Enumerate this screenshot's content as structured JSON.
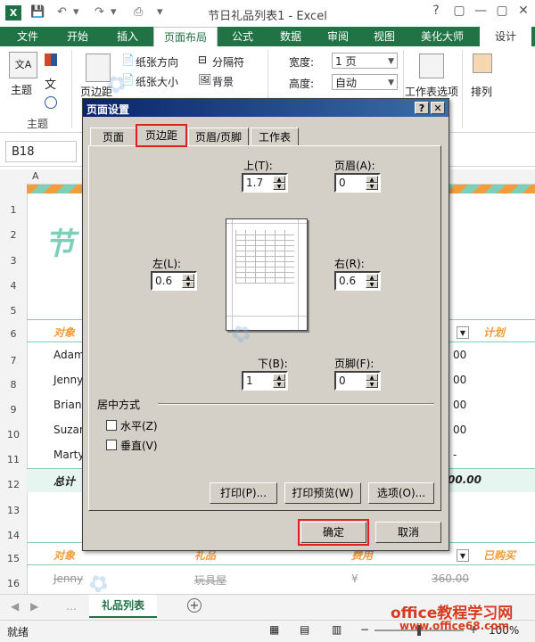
{
  "window": {
    "title": "节日礼品列表1 - Excel",
    "logo": "X",
    "controls": [
      "?",
      "▢",
      "—",
      "▢",
      "✕"
    ]
  },
  "ribbon_tabs": [
    "文件",
    "开始",
    "插入",
    "页面布局",
    "公式",
    "数据",
    "审阅",
    "视图",
    "美化大师",
    "设计"
  ],
  "ribbon": {
    "theme_label": "主题",
    "group_theme": "主题",
    "margins_label": "页边距",
    "orientation_label": "纸张方向",
    "size_label": "纸张大小",
    "breaks_label": "分隔符",
    "background_label": "背景",
    "width_label": "宽度:",
    "height_label": "高度:",
    "width_value": "1 页",
    "height_value": "自动",
    "sheet_options_label": "工作表选项",
    "arrange_label": "排列"
  },
  "formula_bar": {
    "name_box": "B18"
  },
  "sheet": {
    "col_a": "A",
    "row_numbers": [
      "1",
      "2",
      "3",
      "4",
      "5",
      "6",
      "7",
      "8",
      "9",
      "10",
      "11",
      "12",
      "13",
      "14",
      "15",
      "16"
    ],
    "title_partial": "节",
    "header_object": "对象",
    "header_plan": "计划",
    "names": [
      "Adam",
      "Jenny",
      "Brian",
      "Suzan",
      "Marty"
    ],
    "total": "总计",
    "amounts": [
      "00",
      "00",
      "00",
      "00",
      "-"
    ],
    "total_amount": "00.00",
    "lower_header_object": "对象",
    "lower_header_gift": "礼品",
    "lower_header_cost": "费用",
    "lower_header_bought": "已购买",
    "lower_row_name": "Jenny",
    "lower_row_gift": "玩具屋",
    "lower_row_currency": "¥",
    "lower_row_amount": "360.00",
    "sheet_tab": "礼品列表",
    "status": "就绪",
    "zoom": "100%"
  },
  "dialog": {
    "title": "页面设置",
    "tabs": [
      "页面",
      "页边距",
      "页眉/页脚",
      "工作表"
    ],
    "active_tab": "页边距",
    "top_label": "上(T):",
    "top_value": "1.7",
    "header_label": "页眉(A):",
    "header_value": "0",
    "left_label": "左(L):",
    "left_value": "0.6",
    "right_label": "右(R):",
    "right_value": "0.6",
    "bottom_label": "下(B):",
    "bottom_value": "1",
    "footer_label": "页脚(F):",
    "footer_value": "0",
    "center_group": "居中方式",
    "center_h": "水平(Z)",
    "center_v": "垂直(V)",
    "print_btn": "打印(P)...",
    "preview_btn": "打印预览(W)",
    "options_btn": "选项(O)...",
    "ok_btn": "确定",
    "cancel_btn": "取消"
  },
  "watermark": {
    "footer_site": "office教程学习网",
    "footer_url": "www.office68.com"
  },
  "colors": {
    "excel_green": "#217346",
    "dialog_bg": "#d4d0c8",
    "highlight_red": "#e02020",
    "accent_teal": "#7fcfb8",
    "accent_orange": "#f39c3c"
  }
}
